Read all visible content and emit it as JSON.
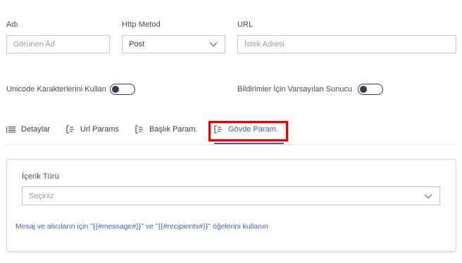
{
  "form": {
    "name": {
      "label": "Adı",
      "placeholder": "Görünen Ad"
    },
    "method": {
      "label": "Http Metod",
      "value": "Post"
    },
    "url": {
      "label": "URL",
      "placeholder": "İstek Adresi"
    },
    "unicode_toggle": {
      "label": "Unicode Karakterlerini Kullan",
      "on": false
    },
    "default_server_toggle": {
      "label": "Bildirimler İçin Varsayılan Sunucu",
      "on": false
    }
  },
  "tabs": [
    {
      "label": "Detaylar",
      "icon": "list-icon",
      "active": false
    },
    {
      "label": "Url Params",
      "icon": "params-icon",
      "active": false
    },
    {
      "label": "Başlık Param.",
      "icon": "params-icon",
      "active": false
    },
    {
      "label": "Gövde Param.",
      "icon": "params-icon",
      "active": true
    }
  ],
  "body_panel": {
    "content_type": {
      "label": "İçerik Türü",
      "placeholder": "Seçiniz"
    },
    "hint": "Mesaj ve alıcıların için \"{{#message#}}\" ve \"{{#recipients#}}\" öğelerini kullanın"
  },
  "colors": {
    "accent": "#3d5bc9",
    "highlight_outline": "#e80000",
    "border": "#c4c4cc"
  }
}
